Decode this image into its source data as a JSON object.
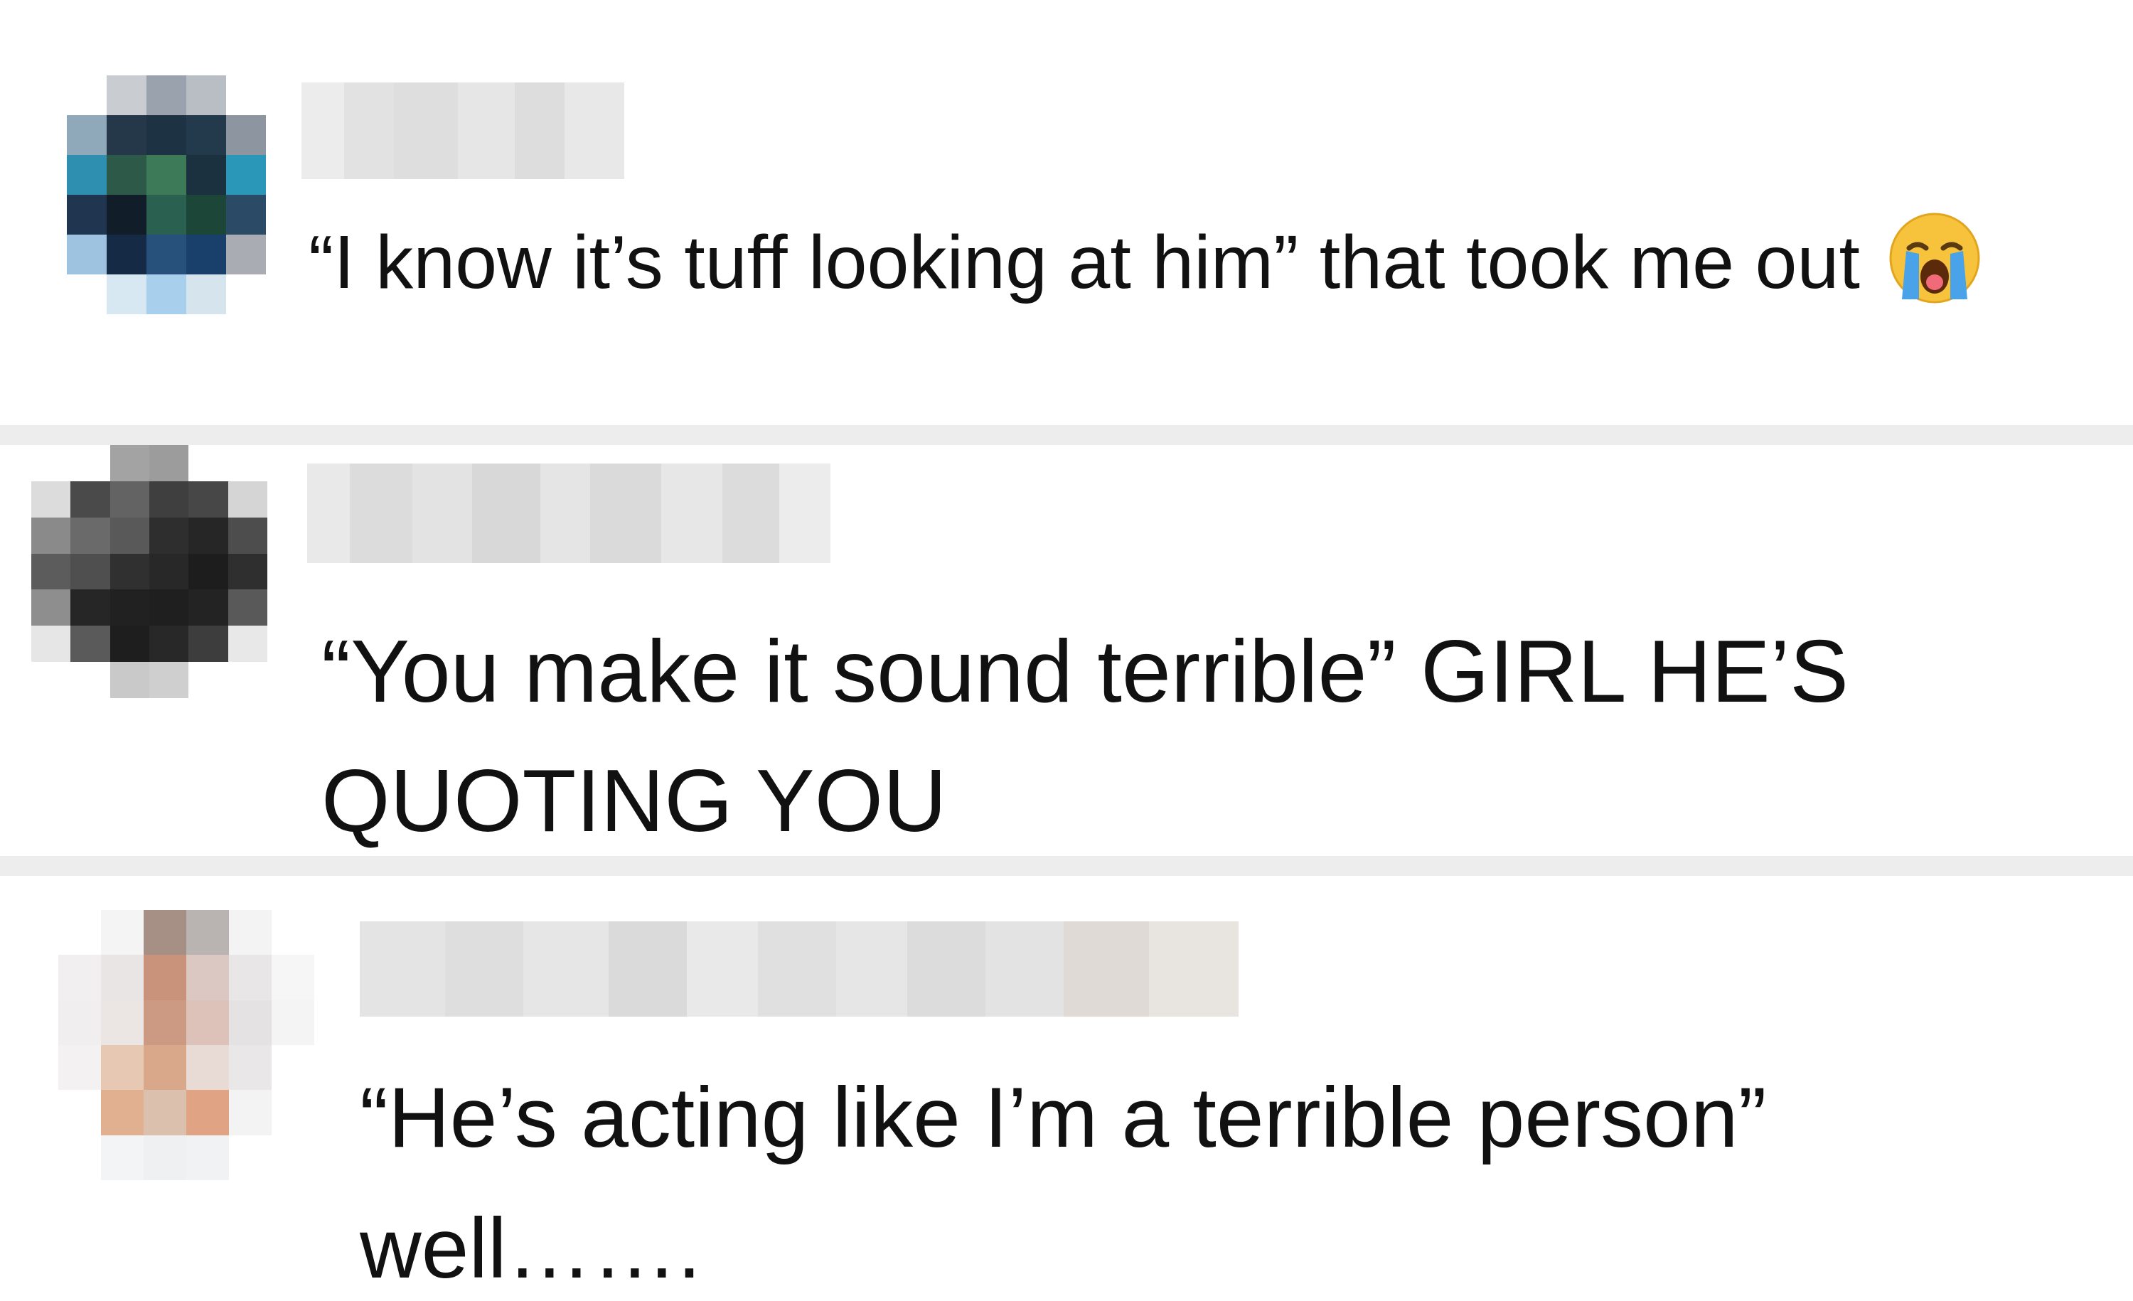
{
  "comments": [
    {
      "text_before_emoji": "“I know it’s tuff looking at him” that took me out ",
      "emoji": "loudly-crying-face-emoji"
    },
    {
      "text": "“You make it sound terrible” GIRL HE’S QUOTING YOU"
    },
    {
      "text": "“He’s acting like I’m a terrible person” well……."
    }
  ],
  "colors": {
    "background": "#ffffff",
    "divider": "#ededed",
    "text": "#111111",
    "emoji_face": "#f7c23c",
    "emoji_tears": "#4aa3e8"
  }
}
